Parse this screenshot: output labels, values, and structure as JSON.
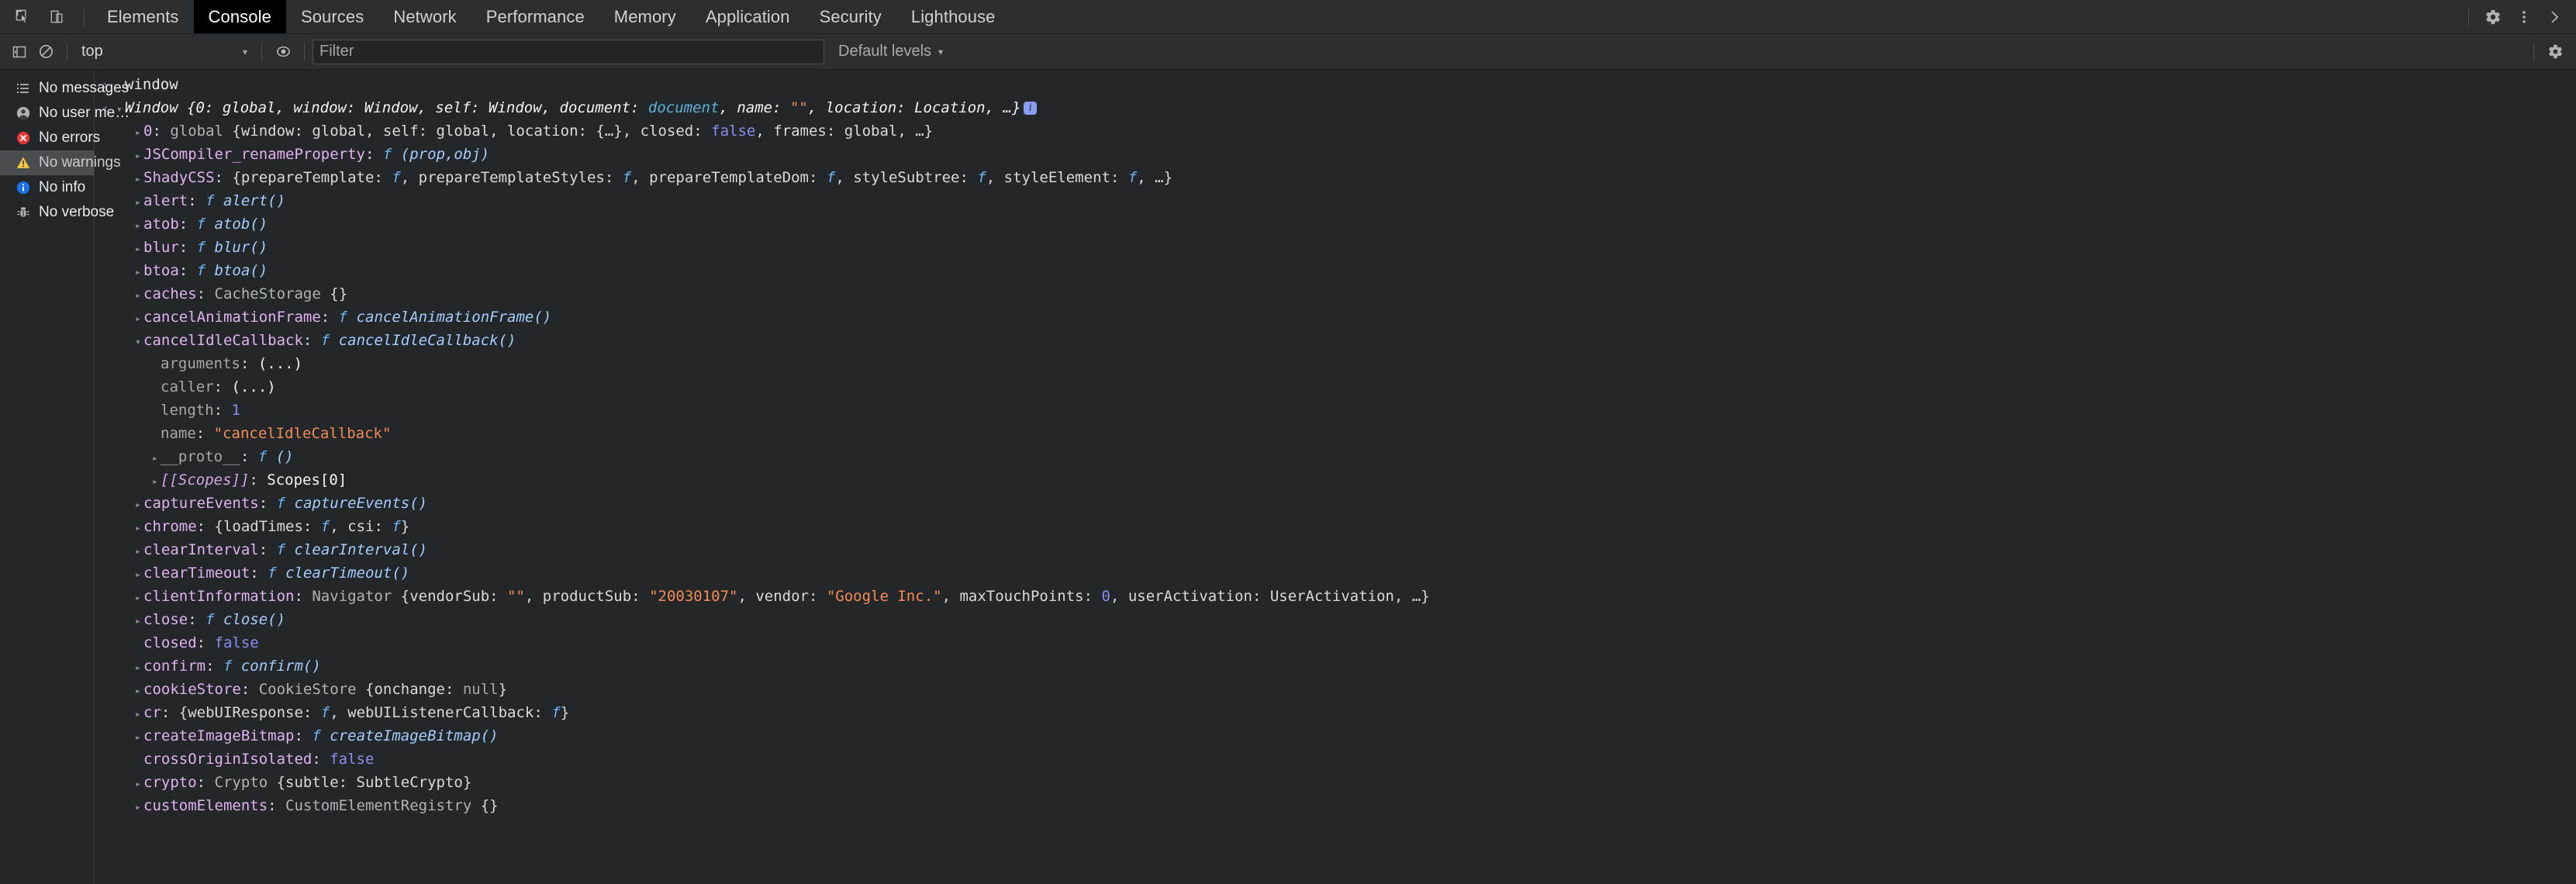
{
  "tabbar": {
    "left_icons": [
      {
        "name": "inspect-element-icon",
        "glyph": "cursor-box"
      },
      {
        "name": "device-toolbar-icon",
        "glyph": "device"
      }
    ],
    "tabs": [
      {
        "label": "Elements",
        "active": false
      },
      {
        "label": "Console",
        "active": true
      },
      {
        "label": "Sources",
        "active": false
      },
      {
        "label": "Network",
        "active": false
      },
      {
        "label": "Performance",
        "active": false
      },
      {
        "label": "Memory",
        "active": false
      },
      {
        "label": "Application",
        "active": false
      },
      {
        "label": "Security",
        "active": false
      },
      {
        "label": "Lighthouse",
        "active": false
      }
    ],
    "right_icons": [
      {
        "name": "settings-gear-icon"
      },
      {
        "name": "more-options-icon"
      },
      {
        "name": "close-devtools-icon"
      }
    ]
  },
  "filterbar": {
    "sidebar_toggle": "console-sidebar-toggle-icon",
    "clear_console": "clear-console-icon",
    "context": "top",
    "context_caret": "▾",
    "eye_icon": "live-expression-eye-icon",
    "filter": {
      "value": "",
      "placeholder": "Filter"
    },
    "levels_label": "Default levels",
    "levels_caret": "▾",
    "settings_icon": "console-settings-gear-icon"
  },
  "sidebar": {
    "items": [
      {
        "label": "No messages",
        "icon": "list-icon",
        "hovered": false
      },
      {
        "label": "No user me…",
        "icon": "person-icon",
        "hovered": false
      },
      {
        "label": "No errors",
        "icon": "error-icon",
        "hovered": false
      },
      {
        "label": "No warnings",
        "icon": "warning-icon",
        "hovered": true
      },
      {
        "label": "No info",
        "icon": "info-icon",
        "hovered": false
      },
      {
        "label": "No verbose",
        "icon": "bug-icon",
        "hovered": false
      }
    ]
  },
  "console": {
    "input_expression": "window",
    "lines": [
      {
        "gutter": "in",
        "arrow": "none",
        "indent": 0,
        "tokens": [
          {
            "t": "window",
            "c": "expr"
          }
        ]
      },
      {
        "gutter": "out",
        "arrow": "open",
        "indent": 0,
        "italic": true,
        "badge": "i",
        "tokens": [
          {
            "t": "Window {",
            "c": "tk-white"
          },
          {
            "t": "0",
            "c": "tk-white"
          },
          {
            "t": ": global, window: Window, self: Window, document: ",
            "c": "tk-white"
          },
          {
            "t": "document",
            "c": "tk-node"
          },
          {
            "t": ", name: ",
            "c": "tk-white"
          },
          {
            "t": "\"\"",
            "c": "tk-str"
          },
          {
            "t": ", location: Location, …}",
            "c": "tk-white"
          }
        ]
      },
      {
        "gutter": "",
        "arrow": "closed",
        "indent": 1,
        "tokens": [
          {
            "t": "0",
            "c": "tk-prop"
          },
          {
            "t": ": ",
            "c": "tk-plain"
          },
          {
            "t": "global ",
            "c": "tk-obj"
          },
          {
            "t": "{window: global, self: global, location: {…}, closed: ",
            "c": "tk-plain"
          },
          {
            "t": "false",
            "c": "tk-bool"
          },
          {
            "t": ", frames: global, …}",
            "c": "tk-plain"
          }
        ]
      },
      {
        "gutter": "",
        "arrow": "closed",
        "indent": 1,
        "tokens": [
          {
            "t": "JSCompiler_renameProperty",
            "c": "tk-prop"
          },
          {
            "t": ": ",
            "c": "tk-plain"
          },
          {
            "t": "f",
            "c": "tk-fnkw"
          },
          {
            "t": " (prop,obj)",
            "c": "tk-fn"
          }
        ]
      },
      {
        "gutter": "",
        "arrow": "closed",
        "indent": 1,
        "tokens": [
          {
            "t": "ShadyCSS",
            "c": "tk-prop"
          },
          {
            "t": ": {prepareTemplate: ",
            "c": "tk-plain"
          },
          {
            "t": "f",
            "c": "tk-fnkw"
          },
          {
            "t": ", prepareTemplateStyles: ",
            "c": "tk-plain"
          },
          {
            "t": "f",
            "c": "tk-fnkw"
          },
          {
            "t": ", prepareTemplateDom: ",
            "c": "tk-plain"
          },
          {
            "t": "f",
            "c": "tk-fnkw"
          },
          {
            "t": ", styleSubtree: ",
            "c": "tk-plain"
          },
          {
            "t": "f",
            "c": "tk-fnkw"
          },
          {
            "t": ", styleElement: ",
            "c": "tk-plain"
          },
          {
            "t": "f",
            "c": "tk-fnkw"
          },
          {
            "t": ", …}",
            "c": "tk-plain"
          }
        ]
      },
      {
        "gutter": "",
        "arrow": "closed",
        "indent": 1,
        "tokens": [
          {
            "t": "alert",
            "c": "tk-prop"
          },
          {
            "t": ": ",
            "c": "tk-plain"
          },
          {
            "t": "f",
            "c": "tk-fnkw"
          },
          {
            "t": " alert()",
            "c": "tk-fn"
          }
        ]
      },
      {
        "gutter": "",
        "arrow": "closed",
        "indent": 1,
        "tokens": [
          {
            "t": "atob",
            "c": "tk-prop"
          },
          {
            "t": ": ",
            "c": "tk-plain"
          },
          {
            "t": "f",
            "c": "tk-fnkw"
          },
          {
            "t": " atob()",
            "c": "tk-fn"
          }
        ]
      },
      {
        "gutter": "",
        "arrow": "closed",
        "indent": 1,
        "tokens": [
          {
            "t": "blur",
            "c": "tk-prop"
          },
          {
            "t": ": ",
            "c": "tk-plain"
          },
          {
            "t": "f",
            "c": "tk-fnkw"
          },
          {
            "t": " blur()",
            "c": "tk-fn"
          }
        ]
      },
      {
        "gutter": "",
        "arrow": "closed",
        "indent": 1,
        "tokens": [
          {
            "t": "btoa",
            "c": "tk-prop"
          },
          {
            "t": ": ",
            "c": "tk-plain"
          },
          {
            "t": "f",
            "c": "tk-fnkw"
          },
          {
            "t": " btoa()",
            "c": "tk-fn"
          }
        ]
      },
      {
        "gutter": "",
        "arrow": "closed",
        "indent": 1,
        "tokens": [
          {
            "t": "caches",
            "c": "tk-prop"
          },
          {
            "t": ": ",
            "c": "tk-plain"
          },
          {
            "t": "CacheStorage ",
            "c": "tk-obj"
          },
          {
            "t": "{}",
            "c": "tk-plain"
          }
        ]
      },
      {
        "gutter": "",
        "arrow": "closed",
        "indent": 1,
        "tokens": [
          {
            "t": "cancelAnimationFrame",
            "c": "tk-prop"
          },
          {
            "t": ": ",
            "c": "tk-plain"
          },
          {
            "t": "f",
            "c": "tk-fnkw"
          },
          {
            "t": " cancelAnimationFrame()",
            "c": "tk-fn"
          }
        ]
      },
      {
        "gutter": "",
        "arrow": "open",
        "indent": 1,
        "tokens": [
          {
            "t": "cancelIdleCallback",
            "c": "tk-prop"
          },
          {
            "t": ": ",
            "c": "tk-plain"
          },
          {
            "t": "f",
            "c": "tk-fnkw"
          },
          {
            "t": " cancelIdleCallback()",
            "c": "tk-fn"
          }
        ]
      },
      {
        "gutter": "",
        "arrow": "none",
        "indent": 2,
        "tokens": [
          {
            "t": "arguments",
            "c": "tk-propdim"
          },
          {
            "t": ": ",
            "c": "tk-plain"
          },
          {
            "t": "(...)",
            "c": "tk-white"
          }
        ]
      },
      {
        "gutter": "",
        "arrow": "none",
        "indent": 2,
        "tokens": [
          {
            "t": "caller",
            "c": "tk-propdim"
          },
          {
            "t": ": ",
            "c": "tk-plain"
          },
          {
            "t": "(...)",
            "c": "tk-white"
          }
        ]
      },
      {
        "gutter": "",
        "arrow": "none",
        "indent": 2,
        "tokens": [
          {
            "t": "length",
            "c": "tk-propdim"
          },
          {
            "t": ": ",
            "c": "tk-plain"
          },
          {
            "t": "1",
            "c": "tk-num"
          }
        ]
      },
      {
        "gutter": "",
        "arrow": "none",
        "indent": 2,
        "tokens": [
          {
            "t": "name",
            "c": "tk-propdim"
          },
          {
            "t": ": ",
            "c": "tk-plain"
          },
          {
            "t": "\"cancelIdleCallback\"",
            "c": "tk-str"
          }
        ]
      },
      {
        "gutter": "",
        "arrow": "closed",
        "indent": 2,
        "tokens": [
          {
            "t": "__proto__",
            "c": "tk-propdim"
          },
          {
            "t": ": ",
            "c": "tk-plain"
          },
          {
            "t": "f",
            "c": "tk-fnkw"
          },
          {
            "t": " ()",
            "c": "tk-fn"
          }
        ]
      },
      {
        "gutter": "",
        "arrow": "closed",
        "indent": 2,
        "tokens": [
          {
            "t": "[[Scopes]]",
            "c": "tk-internal"
          },
          {
            "t": ": ",
            "c": "tk-plain"
          },
          {
            "t": "Scopes[0]",
            "c": "tk-white"
          }
        ]
      },
      {
        "gutter": "",
        "arrow": "closed",
        "indent": 1,
        "tokens": [
          {
            "t": "captureEvents",
            "c": "tk-prop"
          },
          {
            "t": ": ",
            "c": "tk-plain"
          },
          {
            "t": "f",
            "c": "tk-fnkw"
          },
          {
            "t": " captureEvents()",
            "c": "tk-fn"
          }
        ]
      },
      {
        "gutter": "",
        "arrow": "closed",
        "indent": 1,
        "tokens": [
          {
            "t": "chrome",
            "c": "tk-prop"
          },
          {
            "t": ": {loadTimes: ",
            "c": "tk-plain"
          },
          {
            "t": "f",
            "c": "tk-fnkw"
          },
          {
            "t": ", csi: ",
            "c": "tk-plain"
          },
          {
            "t": "f",
            "c": "tk-fnkw"
          },
          {
            "t": "}",
            "c": "tk-plain"
          }
        ]
      },
      {
        "gutter": "",
        "arrow": "closed",
        "indent": 1,
        "tokens": [
          {
            "t": "clearInterval",
            "c": "tk-prop"
          },
          {
            "t": ": ",
            "c": "tk-plain"
          },
          {
            "t": "f",
            "c": "tk-fnkw"
          },
          {
            "t": " clearInterval()",
            "c": "tk-fn"
          }
        ]
      },
      {
        "gutter": "",
        "arrow": "closed",
        "indent": 1,
        "tokens": [
          {
            "t": "clearTimeout",
            "c": "tk-prop"
          },
          {
            "t": ": ",
            "c": "tk-plain"
          },
          {
            "t": "f",
            "c": "tk-fnkw"
          },
          {
            "t": " clearTimeout()",
            "c": "tk-fn"
          }
        ]
      },
      {
        "gutter": "",
        "arrow": "closed",
        "indent": 1,
        "tokens": [
          {
            "t": "clientInformation",
            "c": "tk-prop"
          },
          {
            "t": ": ",
            "c": "tk-plain"
          },
          {
            "t": "Navigator ",
            "c": "tk-obj"
          },
          {
            "t": "{vendorSub: ",
            "c": "tk-plain"
          },
          {
            "t": "\"\"",
            "c": "tk-str"
          },
          {
            "t": ", productSub: ",
            "c": "tk-plain"
          },
          {
            "t": "\"20030107\"",
            "c": "tk-str"
          },
          {
            "t": ", vendor: ",
            "c": "tk-plain"
          },
          {
            "t": "\"Google Inc.\"",
            "c": "tk-str"
          },
          {
            "t": ", maxTouchPoints: ",
            "c": "tk-plain"
          },
          {
            "t": "0",
            "c": "tk-num"
          },
          {
            "t": ", userActivation: UserActivation, …}",
            "c": "tk-plain"
          }
        ]
      },
      {
        "gutter": "",
        "arrow": "closed",
        "indent": 1,
        "tokens": [
          {
            "t": "close",
            "c": "tk-prop"
          },
          {
            "t": ": ",
            "c": "tk-plain"
          },
          {
            "t": "f",
            "c": "tk-fnkw"
          },
          {
            "t": " close()",
            "c": "tk-fn"
          }
        ]
      },
      {
        "gutter": "",
        "arrow": "none",
        "indent": 1,
        "tokens": [
          {
            "t": "closed",
            "c": "tk-prop"
          },
          {
            "t": ": ",
            "c": "tk-plain"
          },
          {
            "t": "false",
            "c": "tk-bool"
          }
        ]
      },
      {
        "gutter": "",
        "arrow": "closed",
        "indent": 1,
        "tokens": [
          {
            "t": "confirm",
            "c": "tk-prop"
          },
          {
            "t": ": ",
            "c": "tk-plain"
          },
          {
            "t": "f",
            "c": "tk-fnkw"
          },
          {
            "t": " confirm()",
            "c": "tk-fn"
          }
        ]
      },
      {
        "gutter": "",
        "arrow": "closed",
        "indent": 1,
        "tokens": [
          {
            "t": "cookieStore",
            "c": "tk-prop"
          },
          {
            "t": ": ",
            "c": "tk-plain"
          },
          {
            "t": "CookieStore ",
            "c": "tk-obj"
          },
          {
            "t": "{onchange: ",
            "c": "tk-plain"
          },
          {
            "t": "null",
            "c": "tk-null"
          },
          {
            "t": "}",
            "c": "tk-plain"
          }
        ]
      },
      {
        "gutter": "",
        "arrow": "closed",
        "indent": 1,
        "tokens": [
          {
            "t": "cr",
            "c": "tk-prop"
          },
          {
            "t": ": {webUIResponse: ",
            "c": "tk-plain"
          },
          {
            "t": "f",
            "c": "tk-fnkw"
          },
          {
            "t": ", webUIListenerCallback: ",
            "c": "tk-plain"
          },
          {
            "t": "f",
            "c": "tk-fnkw"
          },
          {
            "t": "}",
            "c": "tk-plain"
          }
        ]
      },
      {
        "gutter": "",
        "arrow": "closed",
        "indent": 1,
        "tokens": [
          {
            "t": "createImageBitmap",
            "c": "tk-prop"
          },
          {
            "t": ": ",
            "c": "tk-plain"
          },
          {
            "t": "f",
            "c": "tk-fnkw"
          },
          {
            "t": " createImageBitmap()",
            "c": "tk-fn"
          }
        ]
      },
      {
        "gutter": "",
        "arrow": "none",
        "indent": 1,
        "tokens": [
          {
            "t": "crossOriginIsolated",
            "c": "tk-prop"
          },
          {
            "t": ": ",
            "c": "tk-plain"
          },
          {
            "t": "false",
            "c": "tk-bool"
          }
        ]
      },
      {
        "gutter": "",
        "arrow": "closed",
        "indent": 1,
        "tokens": [
          {
            "t": "crypto",
            "c": "tk-prop"
          },
          {
            "t": ": ",
            "c": "tk-plain"
          },
          {
            "t": "Crypto ",
            "c": "tk-obj"
          },
          {
            "t": "{subtle: SubtleCrypto}",
            "c": "tk-plain"
          }
        ]
      },
      {
        "gutter": "",
        "arrow": "closed",
        "indent": 1,
        "tokens": [
          {
            "t": "customElements",
            "c": "tk-prop"
          },
          {
            "t": ": ",
            "c": "tk-plain"
          },
          {
            "t": "CustomElementRegistry ",
            "c": "tk-obj"
          },
          {
            "t": "{}",
            "c": "tk-plain"
          }
        ]
      }
    ]
  },
  "colors": {
    "background": "#242729",
    "toolbar": "#2b2f31",
    "active_tab": "#000000",
    "string": "#f28b54",
    "number": "#8c8cf0",
    "property": "#e1b2f0",
    "node": "#5db0d7",
    "error": "#e53935",
    "warning": "#f6c744",
    "info": "#1a73e8"
  }
}
